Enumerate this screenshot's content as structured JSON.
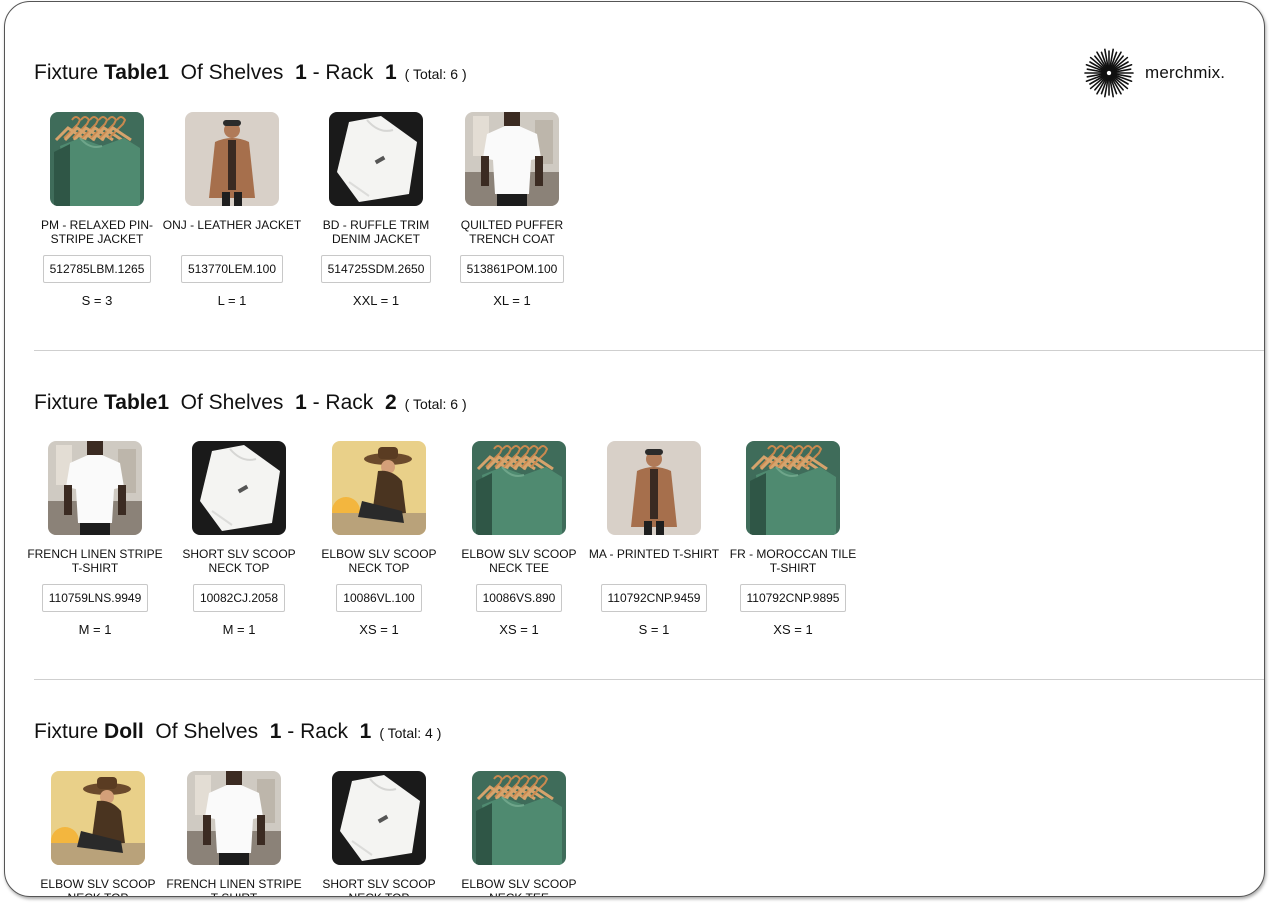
{
  "brand": {
    "name": "merchmix."
  },
  "labels": {
    "fixture": "Fixture",
    "of_shelves": "Of Shelves",
    "rack": "- Rack",
    "total_open": "( Total:",
    "total_close": ")"
  },
  "sections": [
    {
      "fixture": "Table1",
      "shelf": "1",
      "rack": "1",
      "total": "6",
      "items": [
        {
          "name": "PM - RELAXED PIN-STRIPE JACKET",
          "sku": "512785LBM.1265",
          "qty": "S = 3",
          "img": "hangers-green"
        },
        {
          "name": "ONJ - LEATHER JACKET",
          "sku": "513770LEM.100",
          "qty": "L = 1",
          "img": "man-coat"
        },
        {
          "name": "BD - RUFFLE TRIM DENIM JACKET",
          "sku": "514725SDM.2650",
          "qty": "XXL = 1",
          "img": "white-shirt-flat"
        },
        {
          "name": "QUILTED PUFFER TRENCH COAT",
          "sku": "513861POM.100",
          "qty": "XL = 1",
          "img": "man-tee"
        }
      ]
    },
    {
      "fixture": "Table1",
      "shelf": "1",
      "rack": "2",
      "total": "6",
      "items": [
        {
          "name": "FRENCH LINEN STRIPE T-SHIRT",
          "sku": "110759LNS.9949",
          "qty": "M = 1",
          "img": "man-tee"
        },
        {
          "name": "SHORT SLV SCOOP NECK TOP",
          "sku": "10082CJ.2058",
          "qty": "M = 1",
          "img": "white-shirt-flat"
        },
        {
          "name": "ELBOW SLV SCOOP NECK TOP",
          "sku": "10086VL.100",
          "qty": "XS = 1",
          "img": "woman-hat"
        },
        {
          "name": "ELBOW SLV SCOOP NECK TEE",
          "sku": "10086VS.890",
          "qty": "XS = 1",
          "img": "hangers-green"
        },
        {
          "name": "MA - PRINTED T-SHIRT",
          "sku": "110792CNP.9459",
          "qty": "S = 1",
          "img": "man-coat"
        },
        {
          "name": "FR - MOROCCAN TILE T-SHIRT",
          "sku": "110792CNP.9895",
          "qty": "XS = 1",
          "img": "hangers-green"
        }
      ]
    },
    {
      "fixture": "Doll",
      "shelf": "1",
      "rack": "1",
      "total": "4",
      "items": [
        {
          "name": "ELBOW SLV SCOOP NECK TOP",
          "img": "woman-hat"
        },
        {
          "name": "FRENCH LINEN STRIPE T-SHIRT",
          "img": "man-tee"
        },
        {
          "name": "SHORT SLV SCOOP NECK TOP",
          "img": "white-shirt-flat"
        },
        {
          "name": "ELBOW SLV SCOOP NECK TEE",
          "img": "hangers-green"
        }
      ]
    }
  ]
}
